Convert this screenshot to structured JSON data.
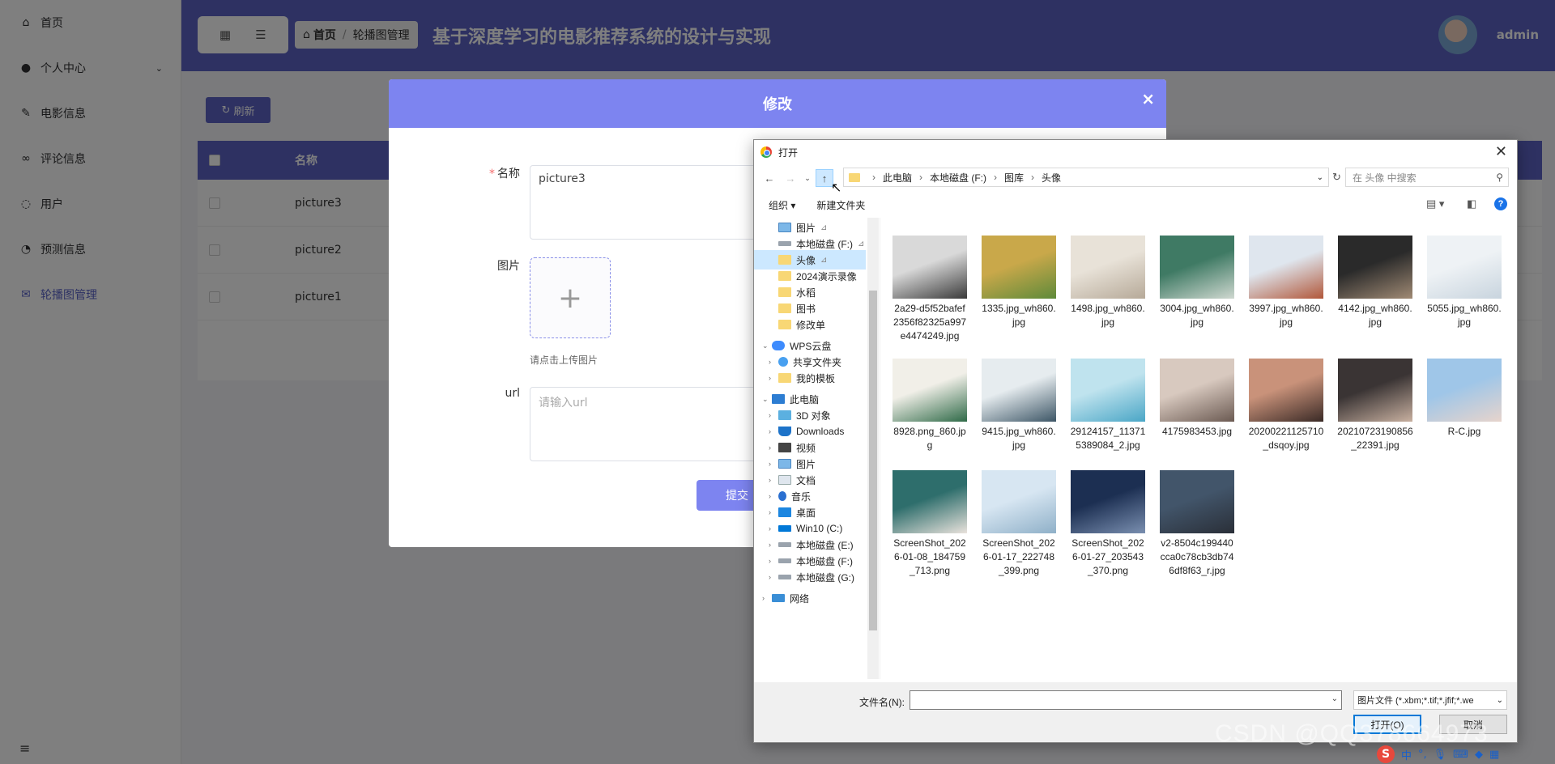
{
  "sidebar": {
    "items": [
      {
        "label": "首页",
        "icon": "home-icon"
      },
      {
        "label": "个人中心",
        "icon": "user-icon"
      },
      {
        "label": "电影信息",
        "icon": "edit-icon"
      },
      {
        "label": "评论信息",
        "icon": "link-icon"
      },
      {
        "label": "用户",
        "icon": "chat-icon"
      },
      {
        "label": "预测信息",
        "icon": "clock-icon"
      },
      {
        "label": "轮播图管理",
        "icon": "mail-icon"
      }
    ],
    "bottom_icon": "menu-icon"
  },
  "header": {
    "breadcrumb": {
      "home": "首页",
      "current": "轮播图管理"
    },
    "title": "基于深度学习的电影推荐系统的设计与实现",
    "username": "admin"
  },
  "content": {
    "refresh_label": "刷新",
    "table": {
      "column": "名称",
      "rows": [
        "picture3",
        "picture2",
        "picture1"
      ]
    }
  },
  "modal": {
    "title": "修改",
    "name_label": "名称",
    "name_value": "picture3",
    "image_label": "图片",
    "upload_hint": "请点击上传图片",
    "url_label": "url",
    "url_placeholder": "请输入url",
    "submit_label": "提交"
  },
  "dialog": {
    "title": "打开",
    "breadcrumb": [
      "此电脑",
      "本地磁盘 (F:)",
      "图库",
      "头像"
    ],
    "search_placeholder": "在 头像 中搜索",
    "organize": "组织 ▾",
    "new_folder": "新建文件夹",
    "tree": [
      {
        "label": "图片",
        "type": "pic",
        "pinned": true
      },
      {
        "label": "本地磁盘 (F:)",
        "type": "drive",
        "pinned": true
      },
      {
        "label": "头像",
        "type": "folder",
        "pinned": true,
        "selected": true
      },
      {
        "label": "2024演示录像",
        "type": "folder"
      },
      {
        "label": "水稻",
        "type": "folder"
      },
      {
        "label": "图书",
        "type": "folder"
      },
      {
        "label": "修改单",
        "type": "folder"
      },
      {
        "label": "WPS云盘",
        "type": "cloud",
        "expanded": true
      },
      {
        "label": "共享文件夹",
        "type": "share"
      },
      {
        "label": "我的模板",
        "type": "folder"
      },
      {
        "label": "此电脑",
        "type": "pc",
        "expanded": true
      },
      {
        "label": "3D 对象",
        "type": "cube"
      },
      {
        "label": "Downloads",
        "type": "down"
      },
      {
        "label": "视频",
        "type": "video"
      },
      {
        "label": "图片",
        "type": "pic"
      },
      {
        "label": "文档",
        "type": "doc"
      },
      {
        "label": "音乐",
        "type": "music"
      },
      {
        "label": "桌面",
        "type": "desk"
      },
      {
        "label": "Win10 (C:)",
        "type": "winc"
      },
      {
        "label": "本地磁盘 (E:)",
        "type": "drive"
      },
      {
        "label": "本地磁盘 (F:)",
        "type": "drive"
      },
      {
        "label": "本地磁盘 (G:)",
        "type": "drive"
      },
      {
        "label": "网络",
        "type": "net"
      }
    ],
    "files": [
      {
        "name": "2a29-d5f52bafef2356f82325a997e4474249.jpg",
        "colors": [
          "#d9d9d9",
          "#3a3a3a"
        ]
      },
      {
        "name": "1335.jpg_wh860.jpg",
        "colors": [
          "#c9a84a",
          "#5e8a3a"
        ]
      },
      {
        "name": "1498.jpg_wh860.jpg",
        "colors": [
          "#e8e2d8",
          "#b6a998"
        ]
      },
      {
        "name": "3004.jpg_wh860.jpg",
        "colors": [
          "#3f7a64",
          "#cfd8d0"
        ]
      },
      {
        "name": "3997.jpg_wh860.jpg",
        "colors": [
          "#dfe6ee",
          "#b1573a"
        ]
      },
      {
        "name": "4142.jpg_wh860.jpg",
        "colors": [
          "#2a2a2a",
          "#a08a74"
        ]
      },
      {
        "name": "5055.jpg_wh860.jpg",
        "colors": [
          "#eef2f5",
          "#c8d4de"
        ]
      },
      {
        "name": "8928.png_860.jpg",
        "colors": [
          "#f1efe8",
          "#2f6a48"
        ]
      },
      {
        "name": "9415.jpg_wh860.jpg",
        "colors": [
          "#e6ecef",
          "#3d5666"
        ]
      },
      {
        "name": "29124157_113715389084_2.jpg",
        "colors": [
          "#bfe3ee",
          "#4aa6c6"
        ]
      },
      {
        "name": "4175983453.jpg",
        "colors": [
          "#d8c9bf",
          "#6b5a52"
        ]
      },
      {
        "name": "20200221125710_dsqoy.jpg",
        "colors": [
          "#c9927a",
          "#3a2a26"
        ]
      },
      {
        "name": "20210723190856_22391.jpg",
        "colors": [
          "#3a3434",
          "#c8b0a0"
        ]
      },
      {
        "name": "R-C.jpg",
        "colors": [
          "#9fc6e8",
          "#e7d4cc"
        ]
      },
      {
        "name": "ScreenShot_2026-01-08_184759_713.png",
        "colors": [
          "#2e6e6c",
          "#e9e2dc"
        ]
      },
      {
        "name": "ScreenShot_2026-01-17_222748_399.png",
        "colors": [
          "#d7e6f2",
          "#8fb0c8"
        ]
      },
      {
        "name": "ScreenShot_2026-01-27_203543_370.png",
        "colors": [
          "#1c2f52",
          "#7a8fb0"
        ]
      },
      {
        "name": "v2-8504c199440cca0c78cb3db746df8f63_r.jpg",
        "colors": [
          "#42556a",
          "#2a2f38"
        ]
      }
    ],
    "filename_label": "文件名(N):",
    "filename_value": "",
    "filetype": "图片文件 (*.xbm;*.tif;*.jfif;*.we",
    "open_label": "打开(O)",
    "cancel_label": "取消"
  },
  "watermark": "CSDN @QQ378664973",
  "tray": {
    "ime": "中"
  },
  "colors": {
    "accent": "#5d63c4",
    "modal_header": "#7d84f0",
    "danger": "#f56c6c"
  }
}
